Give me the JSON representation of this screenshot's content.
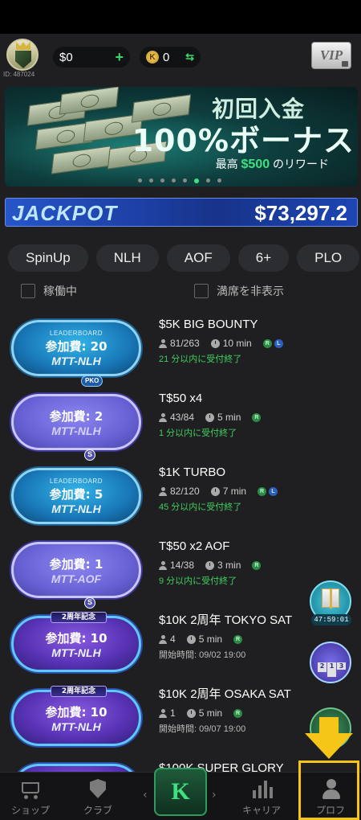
{
  "header": {
    "user_id": "ID: 487024",
    "cash": "$0",
    "cash_add": "+",
    "coin_symbol": "K",
    "coins": "0",
    "coin_exchange": "⇆",
    "vip_label": "VIP"
  },
  "banner": {
    "line1": "初回入金",
    "line2": "100%ボーナス",
    "line3_prefix": "最高",
    "line3_amount": "$500",
    "line3_suffix": "のリワード",
    "page_count": 8,
    "active_page": 6
  },
  "jackpot": {
    "label": "JACKPOT",
    "value": "$73,297.2"
  },
  "filters": [
    "SpinUp",
    "NLH",
    "AOF",
    "6+",
    "PLO"
  ],
  "toggles": {
    "running": "稼働中",
    "hide_full": "満席を非表示"
  },
  "tournaments": [
    {
      "badge_top": "LEADERBOARD",
      "fee": "参加費: 20",
      "type": "MTT-NLH",
      "tag": "PKO",
      "style": "lb",
      "name": "$5K BIG BOUNTY",
      "players": "81/263",
      "time": "10 min",
      "sub": "21 分以内に受付終了"
    },
    {
      "badge_top": "",
      "fee": "参加費: 2",
      "type": "MTT-NLH",
      "tag": "S",
      "style": "plain",
      "name": "T$50 x4",
      "players": "43/84",
      "time": "5 min",
      "sub": "1 分以内に受付終了"
    },
    {
      "badge_top": "LEADERBOARD",
      "fee": "参加費: 5",
      "type": "MTT-NLH",
      "tag": "",
      "style": "lb",
      "name": "$1K TURBO",
      "players": "82/120",
      "time": "7 min",
      "sub": "45 分以内に受付終了"
    },
    {
      "badge_top": "",
      "fee": "参加費: 1",
      "type": "MTT-AOF",
      "tag": "S",
      "style": "plain",
      "name": "T$50 x2 AOF",
      "players": "14/38",
      "time": "3 min",
      "sub": "9 分以内に受付終了"
    },
    {
      "badge_top": "2周年記念",
      "fee": "参加費: 10",
      "type": "MTT-NLH",
      "tag": "",
      "style": "anniv",
      "name": "$10K 2周年 TOKYO SAT",
      "players": "4",
      "time": "5 min",
      "sub": "開始時間: 09/02 19:00"
    },
    {
      "badge_top": "2周年記念",
      "fee": "参加費: 10",
      "type": "MTT-NLH",
      "tag": "",
      "style": "anniv",
      "name": "$10K 2周年 OSAKA SAT",
      "players": "1",
      "time": "5 min",
      "sub": "開始時間: 09/07 19:00"
    },
    {
      "badge_top": "",
      "fee": "",
      "type": "",
      "tag": "",
      "style": "anniv",
      "name": "$100K SUPER GLORY",
      "players": "",
      "time": "",
      "sub": ""
    }
  ],
  "floating": {
    "gift_timer": "47:59:01",
    "podium": [
      "2",
      "1",
      "3"
    ]
  },
  "tabbar": {
    "shop": "ショップ",
    "club": "クラブ",
    "career": "キャリア",
    "profile": "プロフ",
    "center_logo": "K",
    "prev": "‹",
    "next": "›"
  }
}
